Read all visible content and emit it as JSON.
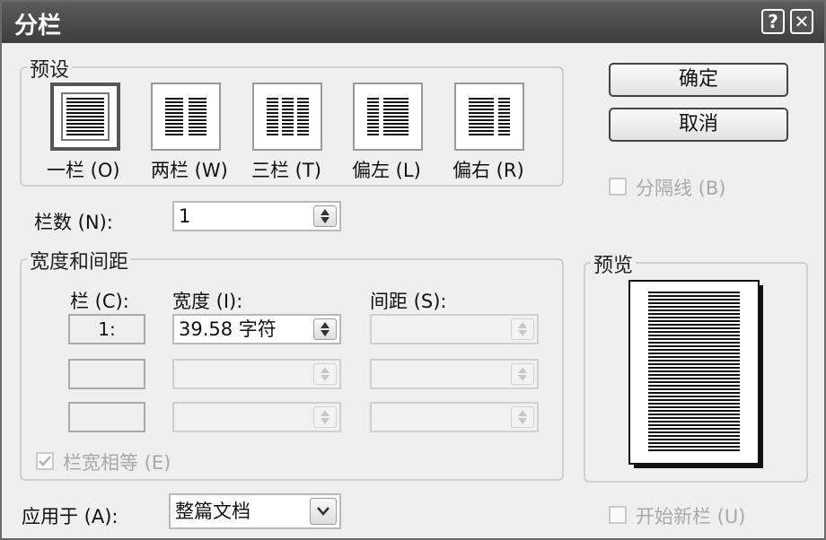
{
  "dialog": {
    "title": "分栏",
    "help_label": "?",
    "close_label": "✕"
  },
  "presets": {
    "legend": "预设",
    "items": [
      {
        "label": "一栏 (O)",
        "selected": true
      },
      {
        "label": "两栏 (W)",
        "selected": false
      },
      {
        "label": "三栏 (T)",
        "selected": false
      },
      {
        "label": "偏左 (L)",
        "selected": false
      },
      {
        "label": "偏右 (R)",
        "selected": false
      }
    ]
  },
  "buttons": {
    "ok_label": "确定",
    "cancel_label": "取消"
  },
  "divider_line": {
    "label": "分隔线 (B)",
    "checked": false,
    "enabled": false
  },
  "num_columns": {
    "label": "栏数 (N):",
    "value": "1"
  },
  "width_spacing": {
    "legend": "宽度和间距",
    "col_header": "栏 (C):",
    "width_header": "宽度 (I):",
    "spacing_header": "间距 (S):",
    "rows": [
      {
        "col": "1:",
        "width": "39.58 字符",
        "spacing": ""
      },
      {
        "col": "",
        "width": "",
        "spacing": ""
      },
      {
        "col": "",
        "width": "",
        "spacing": ""
      }
    ]
  },
  "equal_width": {
    "label": "栏宽相等 (E)",
    "checked": true,
    "enabled": false
  },
  "preview": {
    "legend": "预览"
  },
  "apply_to": {
    "label": "应用于 (A):",
    "value": "整篇文档"
  },
  "start_new_column": {
    "label": "开始新栏 (U)",
    "checked": false,
    "enabled": false
  },
  "colors": {
    "titlebar": "#4a4a4a",
    "dialog_bg": "#efefef",
    "disabled_text": "#a9a9a9"
  }
}
